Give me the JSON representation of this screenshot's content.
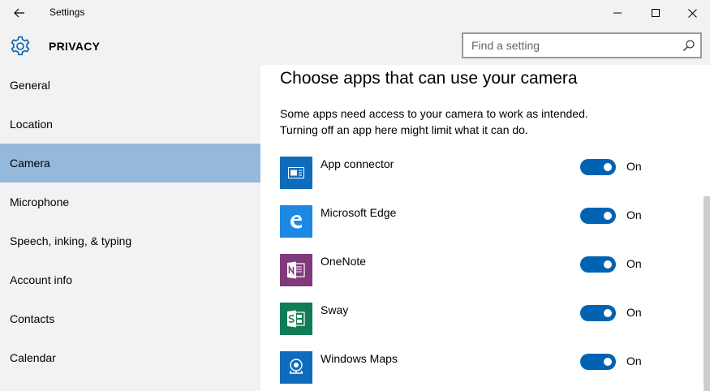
{
  "window": {
    "title": "Settings",
    "back_icon": "back-arrow-icon",
    "controls": [
      "minimize-icon",
      "maximize-icon",
      "close-icon"
    ]
  },
  "header": {
    "section_icon": "gear-icon",
    "section_title": "PRIVACY",
    "search": {
      "placeholder": "Find a setting",
      "value": "",
      "icon": "search-icon"
    }
  },
  "sidebar": {
    "items": [
      {
        "label": "General"
      },
      {
        "label": "Location"
      },
      {
        "label": "Camera",
        "selected": true
      },
      {
        "label": "Microphone"
      },
      {
        "label": "Speech, inking, & typing"
      },
      {
        "label": "Account info"
      },
      {
        "label": "Contacts"
      },
      {
        "label": "Calendar"
      }
    ],
    "selected_color": "#94b9db"
  },
  "main": {
    "heading": "Choose apps that can use your camera",
    "description_line1": "Some apps need access to your camera to work as intended.",
    "description_line2": "Turning off an app here might limit what it can do.",
    "apps": [
      {
        "name": "App connector",
        "state": "On",
        "icon": "app-connector-icon",
        "tile_color": "#0f6cbd"
      },
      {
        "name": "Microsoft Edge",
        "state": "On",
        "icon": "edge-icon",
        "tile_color": "#1e88e5"
      },
      {
        "name": "OneNote",
        "state": "On",
        "icon": "onenote-icon",
        "tile_color": "#80397b"
      },
      {
        "name": "Sway",
        "state": "On",
        "icon": "sway-icon",
        "tile_color": "#107c54"
      },
      {
        "name": "Windows Maps",
        "state": "On",
        "icon": "maps-icon",
        "tile_color": "#0f6cbd"
      }
    ],
    "toggle_on_color": "#0063b1"
  }
}
